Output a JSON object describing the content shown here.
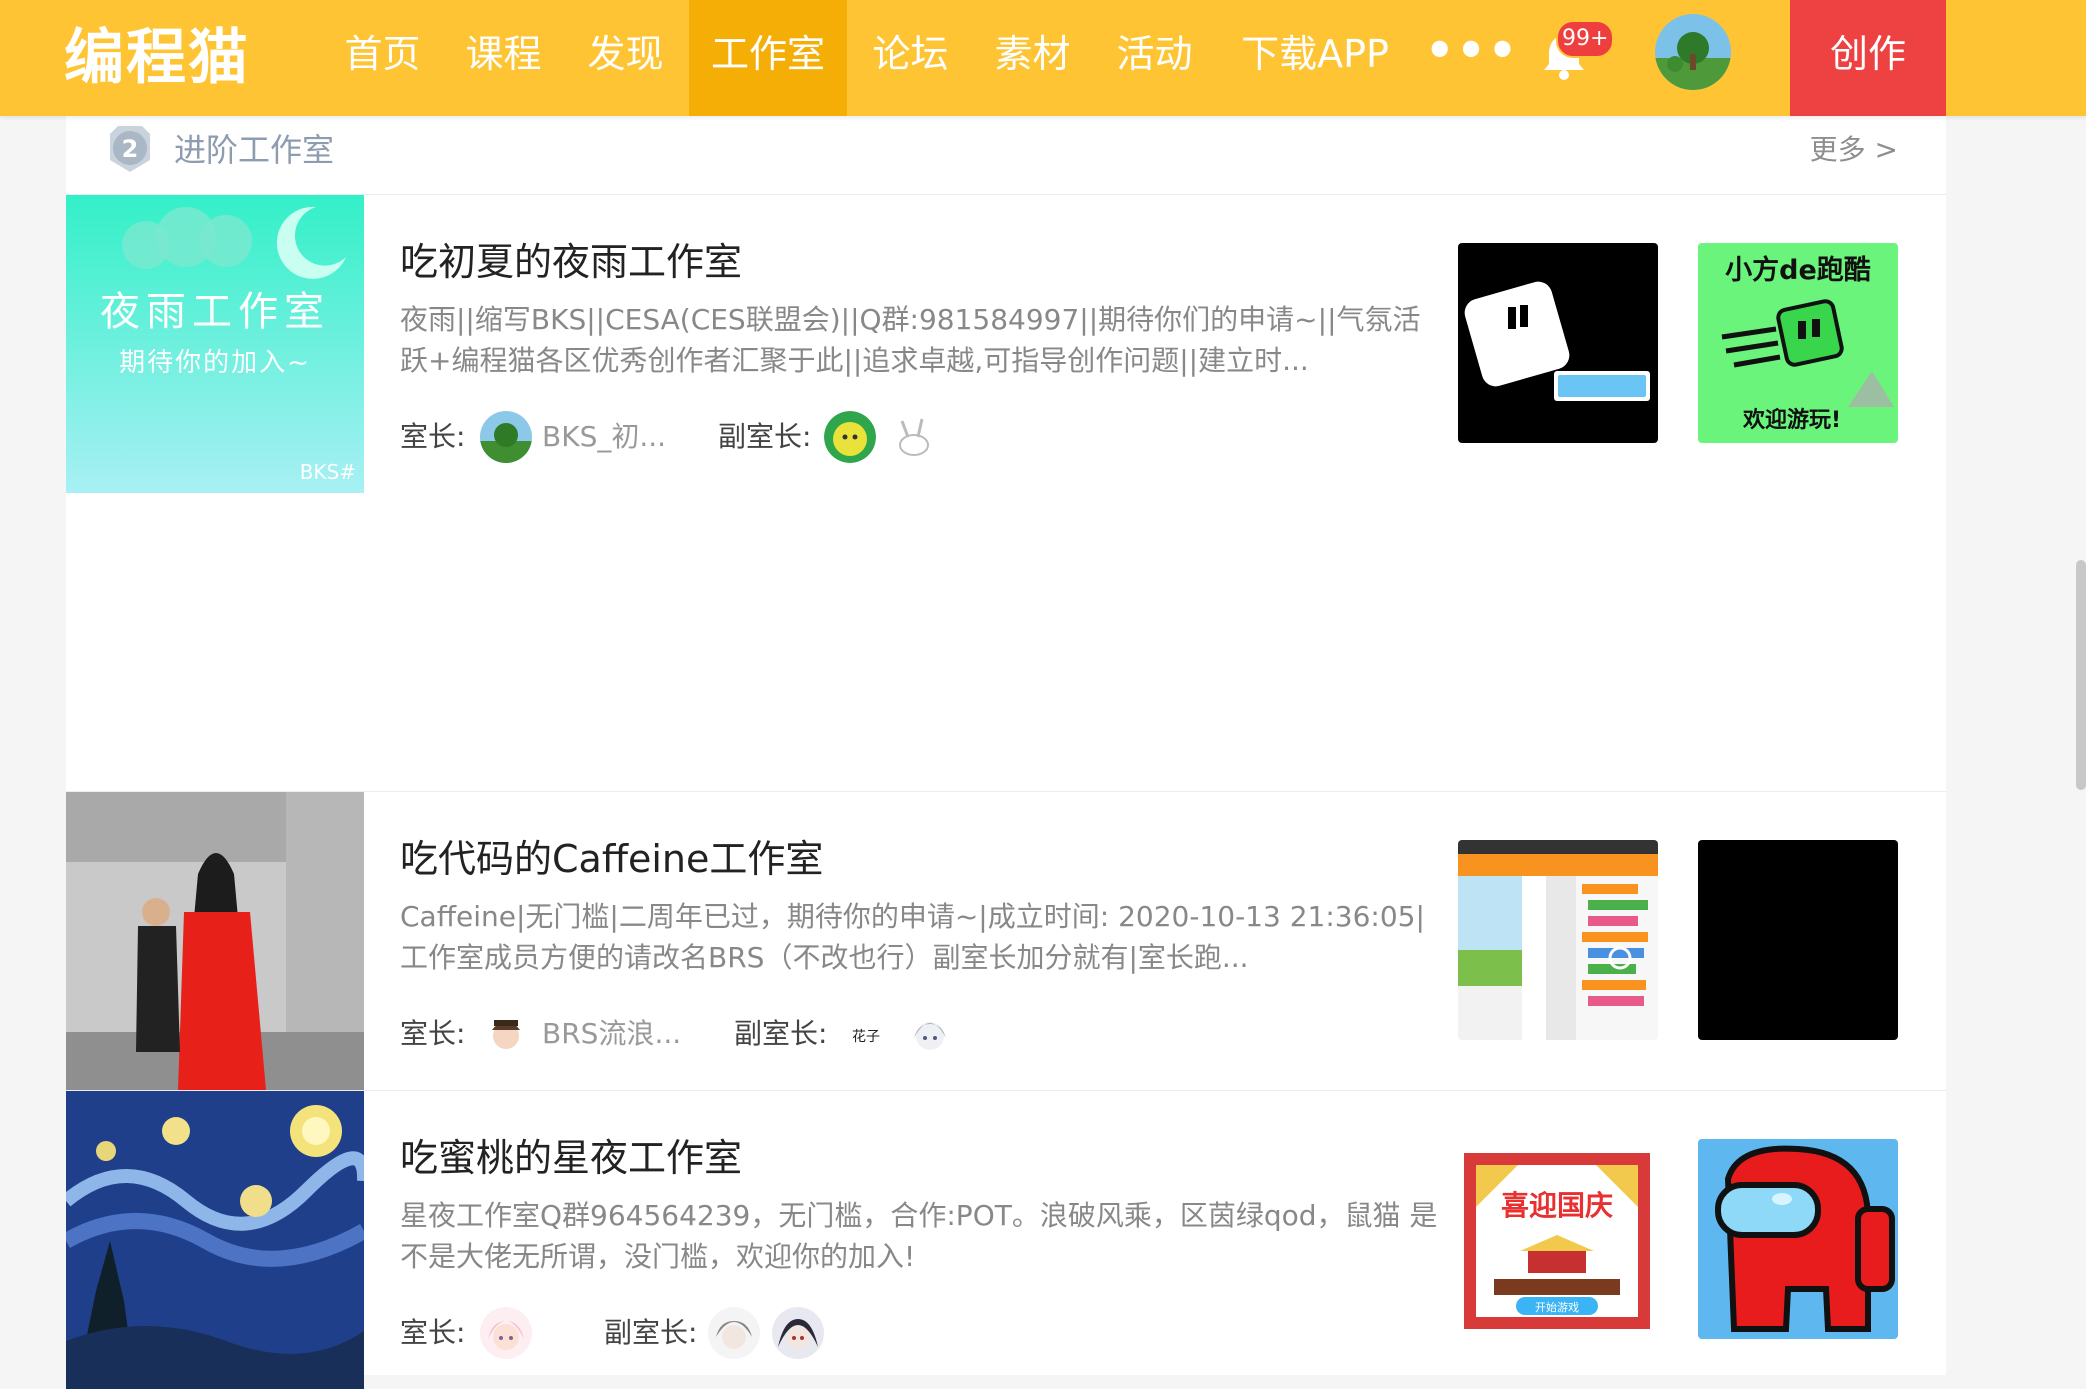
{
  "nav": {
    "logo": "编程猫",
    "items": [
      {
        "label": "首页"
      },
      {
        "label": "课程"
      },
      {
        "label": "发现"
      },
      {
        "label": "工作室"
      },
      {
        "label": "论坛"
      },
      {
        "label": "素材"
      },
      {
        "label": "活动"
      },
      {
        "label": "下载APP"
      }
    ],
    "active_index": 3,
    "more": "•••",
    "notification_count": "99+",
    "create_label": "创作"
  },
  "section": {
    "rank": "2",
    "title": "进阶工作室",
    "more_label": "更多 >"
  },
  "studios": [
    {
      "title": "吃初夏的夜雨工作室",
      "description": "夜雨||缩写BKS||CESA(CES联盟会)||Q群:981584997||期待你们的申请~||气氛活跃+编程猫各区优秀创作者汇聚于此||追求卓越,可指导创作问题||建立时...",
      "owner_label": "室长:",
      "owner_name": "BKS_初...",
      "deputy_label": "副室长:",
      "cover_text": "夜雨工作室",
      "cover_subtext": "期待你的加入~",
      "cover_tag": "BKS#",
      "work2_text1": "小方de跑酷",
      "work2_text2": "欢迎游玩!"
    },
    {
      "title": "吃代码的Caffeine工作室",
      "description": "Caffeine|无门槛|二周年已过，期待你的申请~|成立时间: 2020-10-13 21:36:05|工作室成员方便的请改名BRS（不改也行）副室长加分就有|室长跑...",
      "owner_label": "室长:",
      "owner_name": "BRS流浪...",
      "deputy_label": "副室长:",
      "deputy1_text": "花子"
    },
    {
      "title": "吃蜜桃的星夜工作室",
      "description": "星夜工作室Q群964564239，无门槛，合作:POT。浪破风乘，区茵绿qod，鼠猫 是不是大佬无所谓，没门槛，欢迎你的加入!",
      "owner_label": "室长:",
      "deputy_label": "副室长:",
      "work1_text": "喜迎国庆",
      "work1_button": "开始游戏"
    }
  ],
  "colors": {
    "nav_bg": "#fec433",
    "nav_active": "#f4ae06",
    "create_bg": "#ee4242",
    "badge": "#ee3e3e"
  }
}
